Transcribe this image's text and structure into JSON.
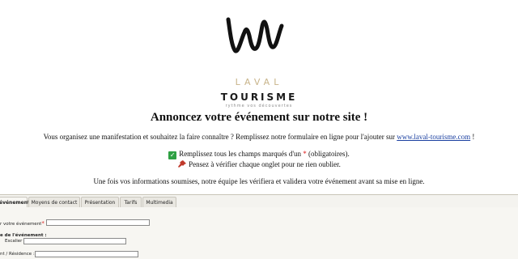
{
  "logo": {
    "brand_top": "LAVAL",
    "brand_bottom": "TOURISME",
    "tagline": "rythme vos découvertes",
    "brand_color": "#c8b48a"
  },
  "page_title": "Annoncez votre événement sur notre site !",
  "intro": {
    "text_before": "Vous organisez une manifestation et souhaitez la faire connaître ? Remplissez notre formulaire en ligne pour l'ajouter sur",
    "link": "www.laval-tourisme.com",
    "text_after": "!"
  },
  "required_hint": {
    "icon": "check-icon",
    "text_before": "Remplissez tous les champs marqués d'un",
    "star": "*",
    "text_after": "(obligatoires)."
  },
  "tabs_hint": {
    "icon": "pin-icon",
    "text": "Pensez à vérifier chaque onglet pour ne rien oublier."
  },
  "review_note": "Une fois vos informations soumises, notre équipe les vérifiera et validera votre événement avant sa mise en ligne.",
  "tabs": [
    {
      "label": "événement",
      "active": true
    },
    {
      "label": "Moyens de contact",
      "active": false
    },
    {
      "label": "Présentation",
      "active": false
    },
    {
      "label": "Tarifs",
      "active": false
    },
    {
      "label": "Multimedia",
      "active": false
    }
  ],
  "form": {
    "event_name_label": "r votre événement",
    "event_name_star": "*",
    "event_name_colon": ":",
    "address_heading": "e de l'événement :",
    "stair_label": "Escalier :",
    "residence_label": "nt / Résidence :"
  }
}
